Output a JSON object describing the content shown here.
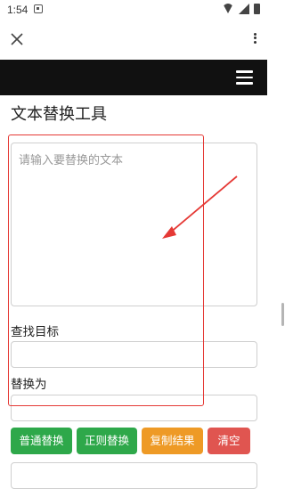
{
  "status_bar": {
    "time": "1:54"
  },
  "page": {
    "title": "文本替换工具",
    "source_placeholder": "请输入要替换的文本",
    "find_label": "查找目标",
    "replace_label": "替换为"
  },
  "buttons": {
    "normal_replace": "普通替换",
    "regex_replace": "正则替换",
    "copy_result": "复制结果",
    "clear": "清空"
  },
  "colors": {
    "nav_background": "#111111",
    "green_button": "#2ea84a",
    "orange_button": "#ee9a26",
    "red_button": "#e05550",
    "annotation": "#e53935"
  },
  "icons": {
    "close": "close-icon",
    "overflow_menu": "more-vert-icon",
    "site_menu": "hamburger-menu-icon"
  }
}
